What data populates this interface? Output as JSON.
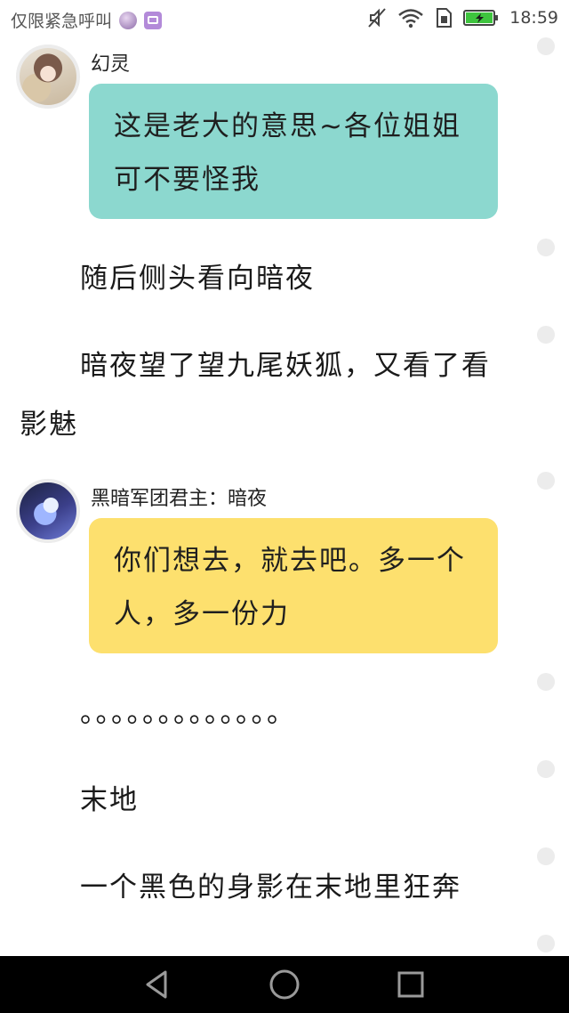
{
  "status_bar": {
    "carrier_text": "仅限紧急呼叫",
    "time": "18:59"
  },
  "messages": [
    {
      "speaker": "幻灵",
      "text": "这是老大的意思~各位姐姐可不要怪我",
      "bubble_color": "#8cd8cf"
    },
    {
      "speaker": "黑暗军团君主：暗夜",
      "text": "你们想去，就去吧。多一个人，多一份力",
      "bubble_color": "#fde06e"
    }
  ],
  "paragraphs": [
    "随后侧头看向暗夜",
    "暗夜望了望九尾妖狐，又看了看影魅",
    "。。。。。。。。。。。。。",
    "末地",
    "一个黑色的身影在末地里狂奔"
  ],
  "icons": {
    "mute": "mute-icon",
    "wifi": "wifi-icon",
    "sim": "sim-icon",
    "battery": "battery-icon",
    "back": "back-icon",
    "home": "home-icon",
    "recent": "recent-apps-icon"
  },
  "colors": {
    "battery_fill": "#3ec43e"
  }
}
